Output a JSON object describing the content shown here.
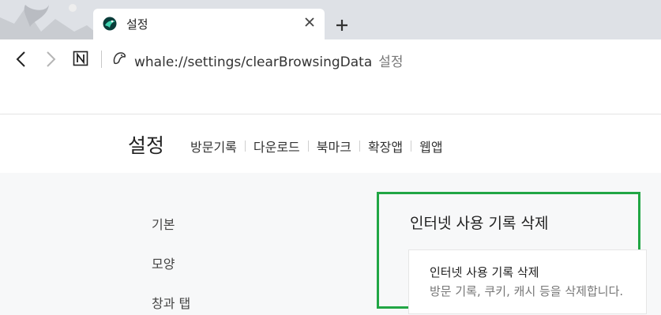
{
  "tabs": [
    {
      "title": "설정",
      "active": true
    }
  ],
  "address_bar": {
    "url": "whale://settings/clearBrowsingData",
    "page_title": "설정"
  },
  "settings_header": {
    "title": "설정",
    "nav": [
      "방문기록",
      "다운로드",
      "북마크",
      "확장앱",
      "웹앱"
    ]
  },
  "sidebar": {
    "items": [
      "기본",
      "모양",
      "창과 탭"
    ]
  },
  "panel": {
    "title": "인터넷 사용 기록 삭제",
    "card_title": "인터넷 사용 기록 삭제",
    "card_description": "방문 기록, 쿠키, 캐시 등을 삭제합니다."
  },
  "colors": {
    "highlight_border": "#21a645",
    "tabstrip_bg": "#dee1e6",
    "content_bg": "#f7f8f9"
  },
  "icons": [
    "whale-logo-icon",
    "close-icon",
    "plus-icon",
    "back-arrow-icon",
    "forward-arrow-icon",
    "reader-mode-icon",
    "whale-site-icon"
  ]
}
